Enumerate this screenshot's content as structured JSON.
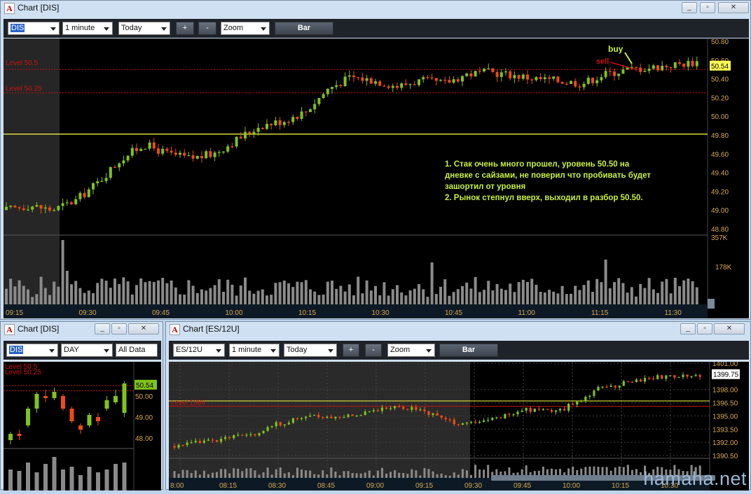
{
  "main": {
    "title": "Chart [DIS]",
    "symbol": "DIS",
    "interval": "1 minute",
    "range": "Today",
    "plus": "+",
    "minus": "-",
    "zoom": "Zoom",
    "bar": "Bar",
    "level_a": "Level 50.5",
    "level_b": "Level 50.25",
    "price_ticks": [
      "50.80",
      "50.60",
      "50.40",
      "50.20",
      "50.00",
      "49.80",
      "49.60",
      "49.40",
      "49.20",
      "49.00",
      "48.80"
    ],
    "last_price": "50.54",
    "vol_ticks": [
      "357K",
      "178K"
    ],
    "time_ticks": [
      "09:15",
      "09:30",
      "09:45",
      "10:00",
      "10:15",
      "10:30",
      "10:45",
      "11:00",
      "11:15",
      "11:30"
    ],
    "buy_label": "buy",
    "sell_label": "sell",
    "note_lines": [
      "1. Стак очень много прошел, уровень 50.50 на",
      "дневке с сайзами, не поверил что пробивать будет",
      "зашортил от уровня",
      "2. Рынок степнул вверх, выходил в разбор 50.50."
    ]
  },
  "daily": {
    "title": "Chart [DIS]",
    "symbol": "DIS",
    "interval": "DAY",
    "range": "All Data",
    "level_a": "Level 50.5",
    "level_b": "Level 50.25",
    "price_ticks": [
      "50.00",
      "49.00",
      "48.00"
    ],
    "last_price": "50.54"
  },
  "es": {
    "title": "Chart [ES/12U]",
    "symbol": "ES/12U",
    "interval": "1 minute",
    "range": "Today",
    "plus": "+",
    "minus": "-",
    "zoom": "Zoom",
    "bar": "Bar",
    "level": "Level 1396",
    "price_ticks": [
      "1401.00",
      "1398.00",
      "1396.50",
      "1395.00",
      "1393.50",
      "1392.00",
      "1390.50"
    ],
    "last_price": "1399.75",
    "time_ticks": [
      "8:00",
      "08:15",
      "08:30",
      "08:45",
      "09:00",
      "09:15",
      "09:30",
      "09:45",
      "10:00",
      "10:15",
      "10:30"
    ]
  },
  "watermark": "hamaha.net",
  "colors": {
    "up": "#7fc31c",
    "down": "#f04a14",
    "level": "#cc1111",
    "yellow": "#ffff44",
    "note": "#c8f040",
    "axis": "#d8a850"
  }
}
